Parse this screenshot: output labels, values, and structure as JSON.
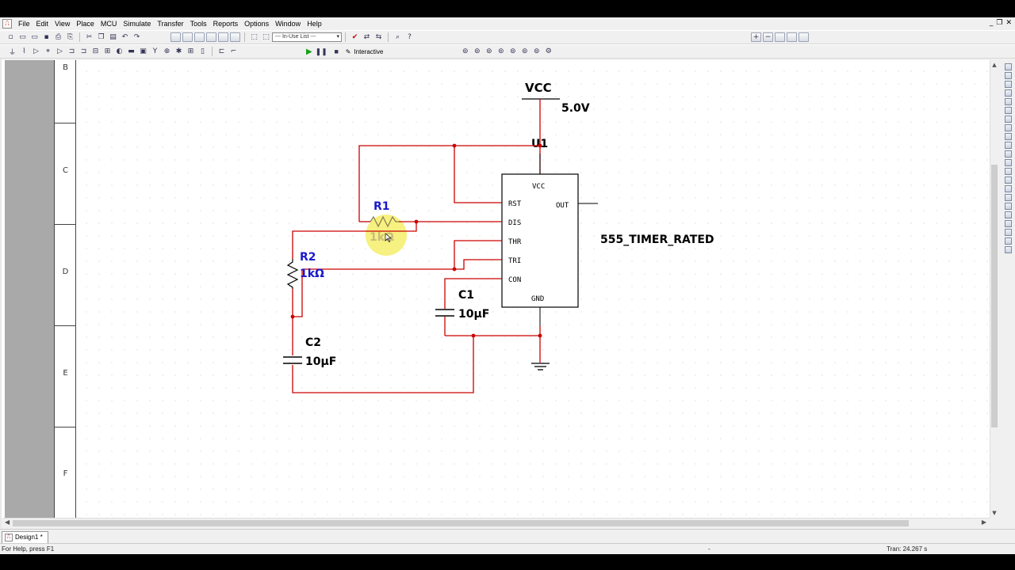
{
  "menu": {
    "items": [
      "File",
      "Edit",
      "View",
      "Place",
      "MCU",
      "Simulate",
      "Transfer",
      "Tools",
      "Reports",
      "Options",
      "Window",
      "Help"
    ]
  },
  "toolbar": {
    "in_use_list": "--- In-Use List ---",
    "interactive_label": "Interactive"
  },
  "sheet": {
    "row_labels": [
      "B",
      "C",
      "D",
      "E",
      "F"
    ]
  },
  "schematic": {
    "vcc_label": "VCC",
    "vcc_value": "5.0V",
    "ic_ref": "U1",
    "ic_name": "555_TIMER_RATED",
    "pins_left": [
      "RST",
      "DIS",
      "THR",
      "TRI",
      "CON"
    ],
    "pin_top": "VCC",
    "pin_bottom": "GND",
    "pin_right": "OUT",
    "r1_ref": "R1",
    "r1_value": "1kΩ",
    "r2_ref": "R2",
    "r2_value": "1kΩ",
    "c1_ref": "C1",
    "c1_value": "10µF",
    "c2_ref": "C2",
    "c2_value": "10µF"
  },
  "tabs": {
    "design": "Design1 *"
  },
  "status": {
    "help": "For Help, press F1",
    "mid": "-",
    "tran": "Tran: 24.267 s"
  },
  "colors": {
    "wire": "#cc0000",
    "component": "#1a1acc",
    "text": "#000000",
    "highlight": "#f5ee6a"
  }
}
